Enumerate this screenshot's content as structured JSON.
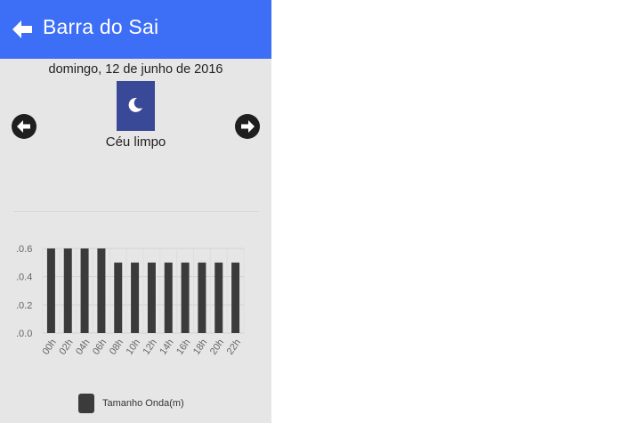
{
  "appbar": {
    "title": "Barra do Sai",
    "color": "#3d6ef6"
  },
  "day": {
    "date": "domingo, 12 de junho de 2016"
  },
  "weather": {
    "icon": "moon-icon",
    "condition": "Céu limpo",
    "icon_bg": "#3a4898"
  },
  "nav": {
    "prev_icon": "arrow-left-icon",
    "next_icon": "arrow-right-icon"
  },
  "chart_data": {
    "type": "bar",
    "categories": [
      "00h",
      "02h",
      "04h",
      "06h",
      "08h",
      "10h",
      "12h",
      "14h",
      "16h",
      "18h",
      "20h",
      "22h"
    ],
    "series": [
      {
        "name": "Tamanho Onda(m)",
        "values": [
          0.6,
          0.6,
          0.6,
          0.6,
          0.5,
          0.5,
          0.5,
          0.5,
          0.5,
          0.5,
          0.5,
          0.5
        ]
      }
    ],
    "yticks": [
      ".0.0",
      ".0.2",
      ".0.4",
      ".0.6"
    ],
    "ylim": [
      0,
      0.6
    ],
    "grid": true,
    "legend": "bottom",
    "bar_color": "#3b3b3b"
  }
}
